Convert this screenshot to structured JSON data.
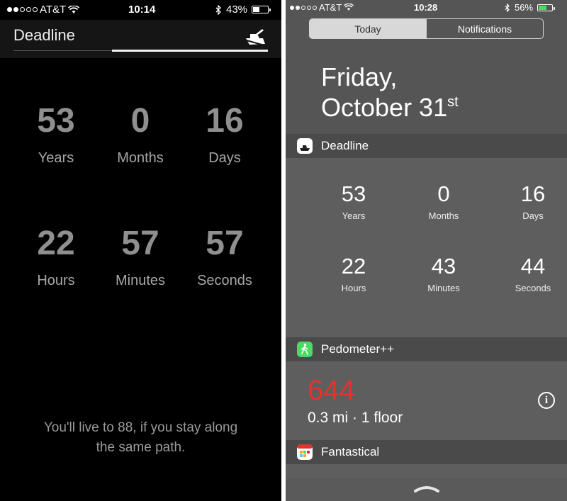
{
  "left": {
    "status": {
      "carrier": "AT&T",
      "time": "10:14",
      "battery": "43%",
      "battery_level": 0.43,
      "signal_bars": 2
    },
    "app_title": "Deadline",
    "counters": [
      {
        "value": "53",
        "label": "Years"
      },
      {
        "value": "0",
        "label": "Months"
      },
      {
        "value": "16",
        "label": "Days"
      },
      {
        "value": "22",
        "label": "Hours"
      },
      {
        "value": "57",
        "label": "Minutes"
      },
      {
        "value": "57",
        "label": "Seconds"
      }
    ],
    "footer_line1": "You'll live to 88, if you stay along",
    "footer_line2": "the same path."
  },
  "right": {
    "status": {
      "carrier": "AT&T",
      "time": "10:28",
      "battery": "56%",
      "battery_level": 0.56,
      "signal_bars": 2
    },
    "tabs": {
      "today": "Today",
      "notifications": "Notifications",
      "selected": "Today"
    },
    "date_line1": "Friday,",
    "date_line2": "October 31",
    "date_suffix": "st",
    "deadline_widget": {
      "title": "Deadline",
      "counters": [
        {
          "value": "53",
          "label": "Years"
        },
        {
          "value": "0",
          "label": "Months"
        },
        {
          "value": "16",
          "label": "Days"
        },
        {
          "value": "22",
          "label": "Hours"
        },
        {
          "value": "43",
          "label": "Minutes"
        },
        {
          "value": "44",
          "label": "Seconds"
        }
      ]
    },
    "pedometer_widget": {
      "title": "Pedometer++",
      "steps": "644",
      "details": "0.3 mi · 1 floor",
      "info_glyph": "i"
    },
    "fantastical_widget": {
      "title": "Fantastical"
    }
  },
  "colors": {
    "steps": "#e8302e",
    "battery_green": "#4cd964",
    "pedometer_icon": "#4cd964"
  }
}
